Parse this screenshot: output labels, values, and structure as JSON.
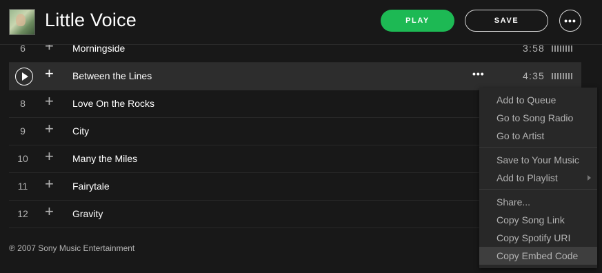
{
  "header": {
    "album_title": "Little Voice",
    "play_label": "PLAY",
    "save_label": "SAVE",
    "more_label": "•••"
  },
  "tracks": [
    {
      "num": "6",
      "title": "Morningside",
      "duration": "3:58",
      "active": false
    },
    {
      "num": "",
      "title": "Between the Lines",
      "duration": "4:35",
      "active": true
    },
    {
      "num": "8",
      "title": "Love On the Rocks",
      "duration": "",
      "active": false
    },
    {
      "num": "9",
      "title": "City",
      "duration": "",
      "active": false
    },
    {
      "num": "10",
      "title": "Many the Miles",
      "duration": "",
      "active": false
    },
    {
      "num": "11",
      "title": "Fairytale",
      "duration": "",
      "active": false
    },
    {
      "num": "12",
      "title": "Gravity",
      "duration": "",
      "active": false
    }
  ],
  "row_more_label": "•••",
  "copyright": "℗ 2007 Sony Music Entertainment",
  "context_menu": {
    "groups": [
      [
        "Add to Queue",
        "Go to Song Radio",
        "Go to Artist"
      ],
      [
        "Save to Your Music",
        "Add to Playlist"
      ],
      [
        "Share...",
        "Copy Song Link",
        "Copy Spotify URI",
        "Copy Embed Code"
      ]
    ],
    "hovered_item": "Copy Embed Code",
    "submenu_item": "Add to Playlist"
  },
  "colors": {
    "background": "#181818",
    "accent": "#1db954",
    "menu_bg": "#282828",
    "menu_hover": "#3e3e3e"
  }
}
